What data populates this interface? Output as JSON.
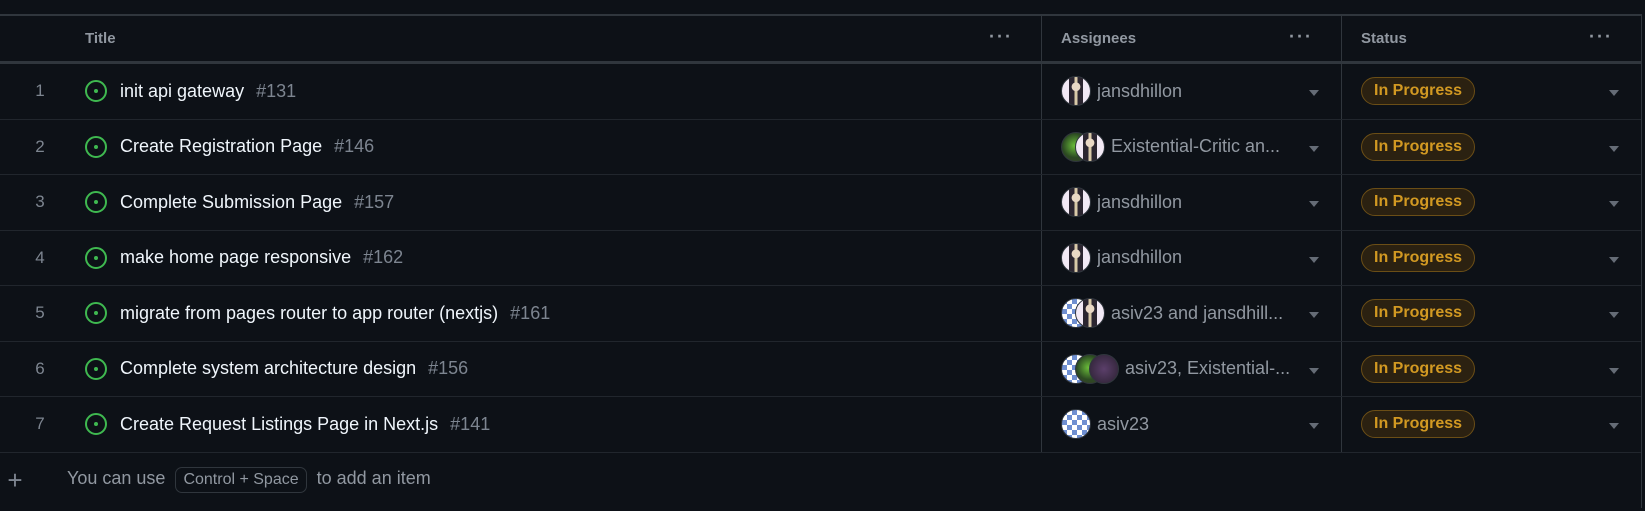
{
  "columns": {
    "title": "Title",
    "assignees": "Assignees",
    "status": "Status"
  },
  "rows": [
    {
      "n": "1",
      "title": "init api gateway",
      "num": "#131",
      "assignees": "jansdhillon",
      "avatars": [
        "j"
      ],
      "status": "In Progress"
    },
    {
      "n": "2",
      "title": "Create Registration Page",
      "num": "#146",
      "assignees": "Existential-Critic an...",
      "avatars": [
        "e",
        "j"
      ],
      "status": "In Progress"
    },
    {
      "n": "3",
      "title": "Complete Submission Page",
      "num": "#157",
      "assignees": "jansdhillon",
      "avatars": [
        "j"
      ],
      "status": "In Progress"
    },
    {
      "n": "4",
      "title": "make home page responsive",
      "num": "#162",
      "assignees": "jansdhillon",
      "avatars": [
        "j"
      ],
      "status": "In Progress"
    },
    {
      "n": "5",
      "title": "migrate from pages router to app router (nextjs)",
      "num": "#161",
      "assignees": "asiv23 and jansdhill...",
      "avatars": [
        "a",
        "j"
      ],
      "status": "In Progress"
    },
    {
      "n": "6",
      "title": "Complete system architecture design",
      "num": "#156",
      "assignees": "asiv23, Existential-...",
      "avatars": [
        "a",
        "e",
        "p"
      ],
      "status": "In Progress"
    },
    {
      "n": "7",
      "title": "Create Request Listings Page in Next.js",
      "num": "#141",
      "assignees": "asiv23",
      "avatars": [
        "a"
      ],
      "status": "In Progress"
    }
  ],
  "add_item": {
    "prefix": "You can use",
    "shortcut": "Control + Space",
    "suffix": "to add an item"
  },
  "colors": {
    "background": "#0d1117",
    "open_issue": "#3fb950",
    "in_progress": "#d29922"
  }
}
